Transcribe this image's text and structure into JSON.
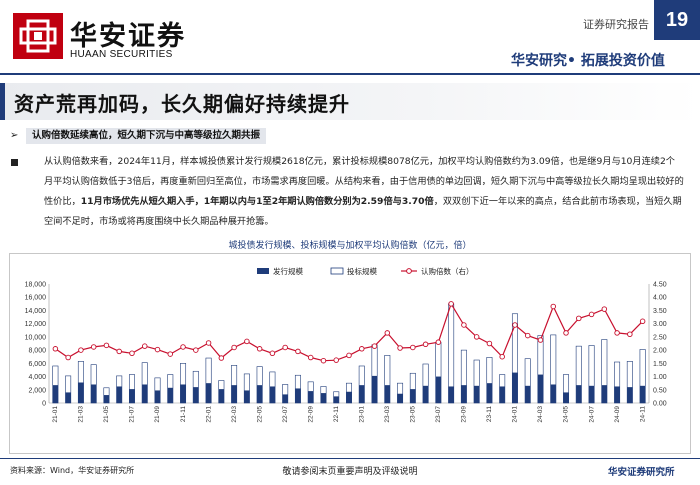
{
  "header": {
    "logo_cn": "华安证券",
    "logo_en": "HUAAN SECURITIES",
    "report_tag": "证券研究报告",
    "page_number": "19",
    "slogan": "华安研究• 拓展投资价值"
  },
  "section": {
    "title": "资产荒再加码，长久期偏好持续提升",
    "subheading": "认购倍数延续高位，短久期下沉与中高等级拉久期共振",
    "body": {
      "p1": "从认购倍数来看，2024年11月，样本城投债累计发行规模2618亿元，累计投标规模8078亿元，加权平均认购倍数约为3.09倍，也是继9月与10月连续2个月平均认购倍数低于3倍后，再度重新回归至高位，市场需求再度回暖。从结构来看，由于信用债的单边回调，短久期下沉与中高等级拉长久期均呈现出较好的性价比，",
      "p2": "11月市场优先从短久期入手，1年期以内与1至2年期认购倍数分别为2.59倍与3.70倍",
      "p3": "，双双创下近一年以来的高点，结合此前市场表现，当短久期空间不足时，市场或将再度围绕中长久期品种展开抢籌。"
    }
  },
  "chart_title": "城投债发行规模、投标规模与加权平均认购倍数（亿元，倍）",
  "chart_data": {
    "type": "bar",
    "legend": {
      "placement": "top-center",
      "items": [
        "发行规模",
        "投标规模",
        "认购倍数（右）"
      ]
    },
    "categories": [
      "21-01",
      "21-02",
      "21-03",
      "21-04",
      "21-05",
      "21-06",
      "21-07",
      "21-08",
      "21-09",
      "21-10",
      "21-11",
      "21-12",
      "22-01",
      "22-02",
      "22-03",
      "22-04",
      "22-05",
      "22-06",
      "22-07",
      "22-08",
      "22-09",
      "22-10",
      "22-11",
      "22-12",
      "23-01",
      "23-02",
      "23-03",
      "23-04",
      "23-05",
      "23-06",
      "23-07",
      "23-08",
      "23-09",
      "23-10",
      "23-11",
      "23-12",
      "24-01",
      "24-02",
      "24-03",
      "24-04",
      "24-05",
      "24-06",
      "24-07",
      "24-08",
      "24-09",
      "24-10",
      "24-11"
    ],
    "x_tick_labels": [
      "21-01",
      "21-03",
      "21-05",
      "21-07",
      "21-09",
      "21-11",
      "22-01",
      "22-03",
      "22-05",
      "22-07",
      "22-09",
      "22-11",
      "23-01",
      "23-03",
      "23-05",
      "23-07",
      "23-09",
      "23-11",
      "24-01",
      "24-03",
      "24-05",
      "24-07",
      "24-09",
      "24-11"
    ],
    "series": [
      {
        "name": "发行规模",
        "color": "#1f3c7a",
        "values": [
          2700,
          1600,
          3100,
          2800,
          1200,
          2500,
          2100,
          2800,
          1900,
          2300,
          2800,
          2400,
          3000,
          2100,
          2700,
          1900,
          2700,
          2500,
          1300,
          2200,
          1800,
          1500,
          1000,
          1700,
          2700,
          4100,
          2700,
          1400,
          2100,
          2600,
          4000,
          2500,
          2700,
          2600,
          3000,
          2500,
          4600,
          2600,
          4300,
          2800,
          1600,
          2700,
          2600,
          2700,
          2500,
          2400,
          2600
        ]
      },
      {
        "name": "投标规模",
        "color": "#ffffff",
        "values": [
          5600,
          4100,
          6300,
          5800,
          2300,
          4100,
          4300,
          6100,
          3800,
          4300,
          6000,
          4800,
          6800,
          3400,
          5700,
          4400,
          5500,
          4700,
          2800,
          4200,
          3200,
          2500,
          1700,
          3000,
          5600,
          8800,
          7200,
          3000,
          4500,
          5900,
          9200,
          15000,
          8000,
          6500,
          6900,
          4300,
          13500,
          6700,
          10200,
          10300,
          4300,
          8600,
          8700,
          9600,
          6200,
          6300,
          8100
        ]
      },
      {
        "name": "认购倍数（右）",
        "color": "#c8102e",
        "axis": "right",
        "values": [
          2.05,
          1.72,
          2.0,
          2.12,
          2.18,
          1.95,
          1.88,
          2.15,
          2.02,
          1.85,
          2.12,
          2.0,
          2.27,
          1.7,
          2.1,
          2.33,
          2.05,
          1.88,
          2.1,
          1.95,
          1.72,
          1.6,
          1.62,
          1.8,
          2.05,
          2.15,
          2.65,
          2.08,
          2.1,
          2.22,
          2.3,
          3.75,
          2.95,
          2.5,
          2.25,
          1.75,
          2.95,
          2.55,
          2.38,
          3.65,
          2.65,
          3.2,
          3.35,
          3.55,
          2.65,
          2.6,
          3.09
        ]
      }
    ],
    "y_left": {
      "min": 0,
      "max": 18000,
      "ticks": [
        "0",
        "2,000",
        "4,000",
        "6,000",
        "8,000",
        "10,000",
        "12,000",
        "14,000",
        "16,000",
        "18,000"
      ]
    },
    "y_right": {
      "min": 0,
      "max": 4.5,
      "ticks": [
        "0.00",
        "0.50",
        "1.00",
        "1.50",
        "2.00",
        "2.50",
        "3.00",
        "3.50",
        "4.00",
        "4.50"
      ]
    },
    "grid": false
  },
  "footer": {
    "source": "资料来源：Wind，华安证券研究所",
    "disclaimer": "敬请参阅末页重要声明及评级说明",
    "firm": "华安证券研究所"
  }
}
